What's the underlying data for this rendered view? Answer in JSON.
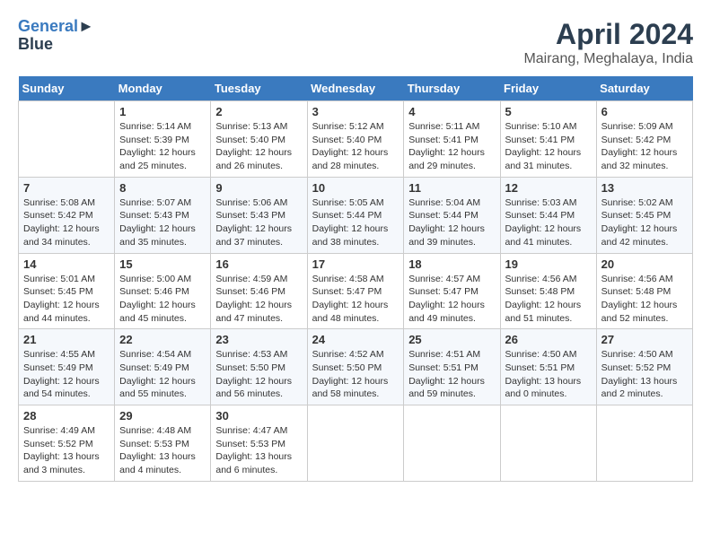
{
  "header": {
    "logo_line1": "General",
    "logo_line2": "Blue",
    "month": "April 2024",
    "location": "Mairang, Meghalaya, India"
  },
  "columns": [
    "Sunday",
    "Monday",
    "Tuesday",
    "Wednesday",
    "Thursday",
    "Friday",
    "Saturday"
  ],
  "weeks": [
    [
      {
        "day": "",
        "info": ""
      },
      {
        "day": "1",
        "info": "Sunrise: 5:14 AM\nSunset: 5:39 PM\nDaylight: 12 hours\nand 25 minutes."
      },
      {
        "day": "2",
        "info": "Sunrise: 5:13 AM\nSunset: 5:40 PM\nDaylight: 12 hours\nand 26 minutes."
      },
      {
        "day": "3",
        "info": "Sunrise: 5:12 AM\nSunset: 5:40 PM\nDaylight: 12 hours\nand 28 minutes."
      },
      {
        "day": "4",
        "info": "Sunrise: 5:11 AM\nSunset: 5:41 PM\nDaylight: 12 hours\nand 29 minutes."
      },
      {
        "day": "5",
        "info": "Sunrise: 5:10 AM\nSunset: 5:41 PM\nDaylight: 12 hours\nand 31 minutes."
      },
      {
        "day": "6",
        "info": "Sunrise: 5:09 AM\nSunset: 5:42 PM\nDaylight: 12 hours\nand 32 minutes."
      }
    ],
    [
      {
        "day": "7",
        "info": "Sunrise: 5:08 AM\nSunset: 5:42 PM\nDaylight: 12 hours\nand 34 minutes."
      },
      {
        "day": "8",
        "info": "Sunrise: 5:07 AM\nSunset: 5:43 PM\nDaylight: 12 hours\nand 35 minutes."
      },
      {
        "day": "9",
        "info": "Sunrise: 5:06 AM\nSunset: 5:43 PM\nDaylight: 12 hours\nand 37 minutes."
      },
      {
        "day": "10",
        "info": "Sunrise: 5:05 AM\nSunset: 5:44 PM\nDaylight: 12 hours\nand 38 minutes."
      },
      {
        "day": "11",
        "info": "Sunrise: 5:04 AM\nSunset: 5:44 PM\nDaylight: 12 hours\nand 39 minutes."
      },
      {
        "day": "12",
        "info": "Sunrise: 5:03 AM\nSunset: 5:44 PM\nDaylight: 12 hours\nand 41 minutes."
      },
      {
        "day": "13",
        "info": "Sunrise: 5:02 AM\nSunset: 5:45 PM\nDaylight: 12 hours\nand 42 minutes."
      }
    ],
    [
      {
        "day": "14",
        "info": "Sunrise: 5:01 AM\nSunset: 5:45 PM\nDaylight: 12 hours\nand 44 minutes."
      },
      {
        "day": "15",
        "info": "Sunrise: 5:00 AM\nSunset: 5:46 PM\nDaylight: 12 hours\nand 45 minutes."
      },
      {
        "day": "16",
        "info": "Sunrise: 4:59 AM\nSunset: 5:46 PM\nDaylight: 12 hours\nand 47 minutes."
      },
      {
        "day": "17",
        "info": "Sunrise: 4:58 AM\nSunset: 5:47 PM\nDaylight: 12 hours\nand 48 minutes."
      },
      {
        "day": "18",
        "info": "Sunrise: 4:57 AM\nSunset: 5:47 PM\nDaylight: 12 hours\nand 49 minutes."
      },
      {
        "day": "19",
        "info": "Sunrise: 4:56 AM\nSunset: 5:48 PM\nDaylight: 12 hours\nand 51 minutes."
      },
      {
        "day": "20",
        "info": "Sunrise: 4:56 AM\nSunset: 5:48 PM\nDaylight: 12 hours\nand 52 minutes."
      }
    ],
    [
      {
        "day": "21",
        "info": "Sunrise: 4:55 AM\nSunset: 5:49 PM\nDaylight: 12 hours\nand 54 minutes."
      },
      {
        "day": "22",
        "info": "Sunrise: 4:54 AM\nSunset: 5:49 PM\nDaylight: 12 hours\nand 55 minutes."
      },
      {
        "day": "23",
        "info": "Sunrise: 4:53 AM\nSunset: 5:50 PM\nDaylight: 12 hours\nand 56 minutes."
      },
      {
        "day": "24",
        "info": "Sunrise: 4:52 AM\nSunset: 5:50 PM\nDaylight: 12 hours\nand 58 minutes."
      },
      {
        "day": "25",
        "info": "Sunrise: 4:51 AM\nSunset: 5:51 PM\nDaylight: 12 hours\nand 59 minutes."
      },
      {
        "day": "26",
        "info": "Sunrise: 4:50 AM\nSunset: 5:51 PM\nDaylight: 13 hours\nand 0 minutes."
      },
      {
        "day": "27",
        "info": "Sunrise: 4:50 AM\nSunset: 5:52 PM\nDaylight: 13 hours\nand 2 minutes."
      }
    ],
    [
      {
        "day": "28",
        "info": "Sunrise: 4:49 AM\nSunset: 5:52 PM\nDaylight: 13 hours\nand 3 minutes."
      },
      {
        "day": "29",
        "info": "Sunrise: 4:48 AM\nSunset: 5:53 PM\nDaylight: 13 hours\nand 4 minutes."
      },
      {
        "day": "30",
        "info": "Sunrise: 4:47 AM\nSunset: 5:53 PM\nDaylight: 13 hours\nand 6 minutes."
      },
      {
        "day": "",
        "info": ""
      },
      {
        "day": "",
        "info": ""
      },
      {
        "day": "",
        "info": ""
      },
      {
        "day": "",
        "info": ""
      }
    ]
  ]
}
